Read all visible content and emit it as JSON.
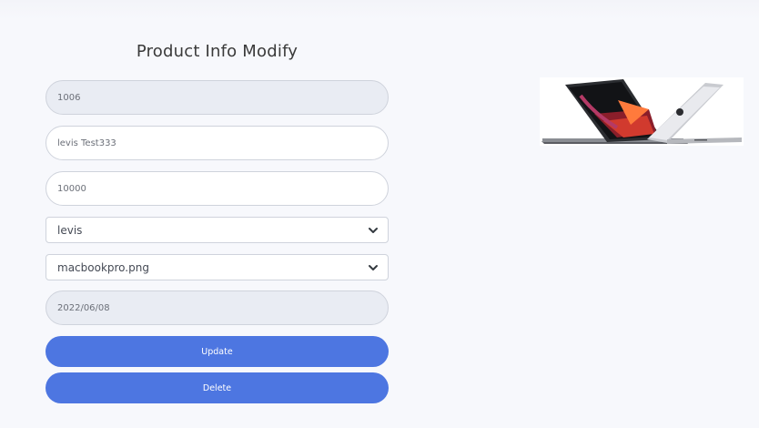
{
  "page": {
    "title": "Product Info Modify"
  },
  "form": {
    "product_id": "1006",
    "product_name": "levis Test333",
    "price": "10000",
    "brand": {
      "selected": "levis"
    },
    "image_file": {
      "selected": "macbookpro.png"
    },
    "date": "2022/06/08",
    "update_label": "Update",
    "delete_label": "Delete"
  },
  "icons": {
    "dropdown": "chevron-down-icon"
  },
  "colors": {
    "primary_button": "#4d76e1",
    "readonly_field": "#e9ecf3",
    "background": "#f7f8fc"
  }
}
